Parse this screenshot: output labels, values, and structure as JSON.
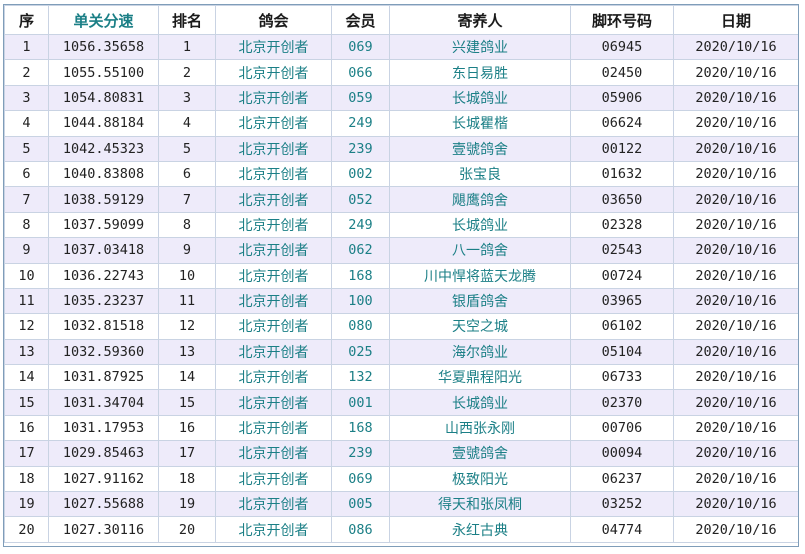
{
  "headers": {
    "index": "序",
    "speed": "单关分速",
    "rank": "排名",
    "club": "鸽会",
    "member": "会员",
    "owner": "寄养人",
    "ring": "脚环号码",
    "date": "日期"
  },
  "colors": {
    "accent_text": "#1b7f86",
    "odd_row_bg": "#eeebfa",
    "grid_line": "#c9d3e3"
  },
  "rows": [
    {
      "index": "1",
      "speed": "1056.35658",
      "rank": "1",
      "club": "北京开创者",
      "member": "069",
      "owner": "兴建鸽业",
      "ring": "06945",
      "date": "2020/10/16"
    },
    {
      "index": "2",
      "speed": "1055.55100",
      "rank": "2",
      "club": "北京开创者",
      "member": "066",
      "owner": "东日易胜",
      "ring": "02450",
      "date": "2020/10/16"
    },
    {
      "index": "3",
      "speed": "1054.80831",
      "rank": "3",
      "club": "北京开创者",
      "member": "059",
      "owner": "长城鸽业",
      "ring": "05906",
      "date": "2020/10/16"
    },
    {
      "index": "4",
      "speed": "1044.88184",
      "rank": "4",
      "club": "北京开创者",
      "member": "249",
      "owner": "长城瞿楷",
      "ring": "06624",
      "date": "2020/10/16"
    },
    {
      "index": "5",
      "speed": "1042.45323",
      "rank": "5",
      "club": "北京开创者",
      "member": "239",
      "owner": "壹號鸽舍",
      "ring": "00122",
      "date": "2020/10/16"
    },
    {
      "index": "6",
      "speed": "1040.83808",
      "rank": "6",
      "club": "北京开创者",
      "member": "002",
      "owner": "张宝良",
      "ring": "01632",
      "date": "2020/10/16"
    },
    {
      "index": "7",
      "speed": "1038.59129",
      "rank": "7",
      "club": "北京开创者",
      "member": "052",
      "owner": "飓鹰鸽舍",
      "ring": "03650",
      "date": "2020/10/16"
    },
    {
      "index": "8",
      "speed": "1037.59099",
      "rank": "8",
      "club": "北京开创者",
      "member": "249",
      "owner": "长城鸽业",
      "ring": "02328",
      "date": "2020/10/16"
    },
    {
      "index": "9",
      "speed": "1037.03418",
      "rank": "9",
      "club": "北京开创者",
      "member": "062",
      "owner": "八一鸽舍",
      "ring": "02543",
      "date": "2020/10/16"
    },
    {
      "index": "10",
      "speed": "1036.22743",
      "rank": "10",
      "club": "北京开创者",
      "member": "168",
      "owner": "川中悍将蓝天龙腾",
      "ring": "00724",
      "date": "2020/10/16"
    },
    {
      "index": "11",
      "speed": "1035.23237",
      "rank": "11",
      "club": "北京开创者",
      "member": "100",
      "owner": "银盾鸽舍",
      "ring": "03965",
      "date": "2020/10/16"
    },
    {
      "index": "12",
      "speed": "1032.81518",
      "rank": "12",
      "club": "北京开创者",
      "member": "080",
      "owner": "天空之城",
      "ring": "06102",
      "date": "2020/10/16"
    },
    {
      "index": "13",
      "speed": "1032.59360",
      "rank": "13",
      "club": "北京开创者",
      "member": "025",
      "owner": "海尔鸽业",
      "ring": "05104",
      "date": "2020/10/16"
    },
    {
      "index": "14",
      "speed": "1031.87925",
      "rank": "14",
      "club": "北京开创者",
      "member": "132",
      "owner": "华夏鼎程阳光",
      "ring": "06733",
      "date": "2020/10/16"
    },
    {
      "index": "15",
      "speed": "1031.34704",
      "rank": "15",
      "club": "北京开创者",
      "member": "001",
      "owner": "长城鸽业",
      "ring": "02370",
      "date": "2020/10/16"
    },
    {
      "index": "16",
      "speed": "1031.17953",
      "rank": "16",
      "club": "北京开创者",
      "member": "168",
      "owner": "山西张永刚",
      "ring": "00706",
      "date": "2020/10/16"
    },
    {
      "index": "17",
      "speed": "1029.85463",
      "rank": "17",
      "club": "北京开创者",
      "member": "239",
      "owner": "壹號鸽舍",
      "ring": "00094",
      "date": "2020/10/16"
    },
    {
      "index": "18",
      "speed": "1027.91162",
      "rank": "18",
      "club": "北京开创者",
      "member": "069",
      "owner": "极致阳光",
      "ring": "06237",
      "date": "2020/10/16"
    },
    {
      "index": "19",
      "speed": "1027.55688",
      "rank": "19",
      "club": "北京开创者",
      "member": "005",
      "owner": "得天和张凤桐",
      "ring": "03252",
      "date": "2020/10/16"
    },
    {
      "index": "20",
      "speed": "1027.30116",
      "rank": "20",
      "club": "北京开创者",
      "member": "086",
      "owner": "永红古典",
      "ring": "04774",
      "date": "2020/10/16"
    }
  ]
}
